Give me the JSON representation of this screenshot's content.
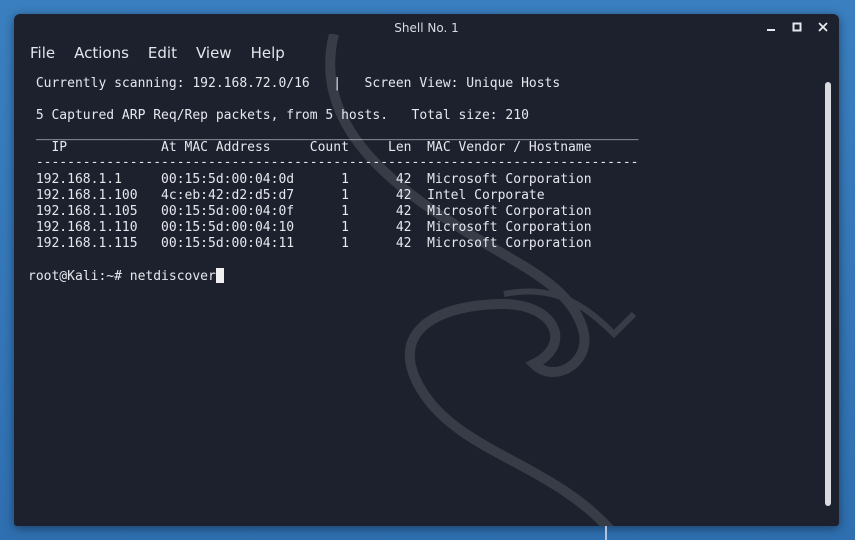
{
  "window": {
    "title": "Shell No. 1",
    "controls": [
      "minimize-icon",
      "maximize-icon",
      "close-icon"
    ]
  },
  "menu": [
    "File",
    "Actions",
    "Edit",
    "View",
    "Help"
  ],
  "terminal": {
    "header_line1": " Currently scanning: 192.168.72.0/16   |   Screen View: Unique Hosts",
    "header_line2": " 5 Captured ARP Req/Rep packets, from 5 hosts.   Total size: 210",
    "rule_top": " _____________________________________________________________________________",
    "columns": "   IP            At MAC Address     Count     Len  MAC Vendor / Hostname",
    "rule_bottom": " -----------------------------------------------------------------------------",
    "rows": [
      " 192.168.1.1     00:15:5d:00:04:0d      1      42  Microsoft Corporation",
      " 192.168.1.100   4c:eb:42:d2:d5:d7      1      42  Intel Corporate",
      " 192.168.1.105   00:15:5d:00:04:0f      1      42  Microsoft Corporation",
      " 192.168.1.110   00:15:5d:00:04:10      1      42  Microsoft Corporation",
      " 192.168.1.115   00:15:5d:00:04:11      1      42  Microsoft Corporation"
    ],
    "prompt": "root@Kali:~# netdiscover"
  }
}
